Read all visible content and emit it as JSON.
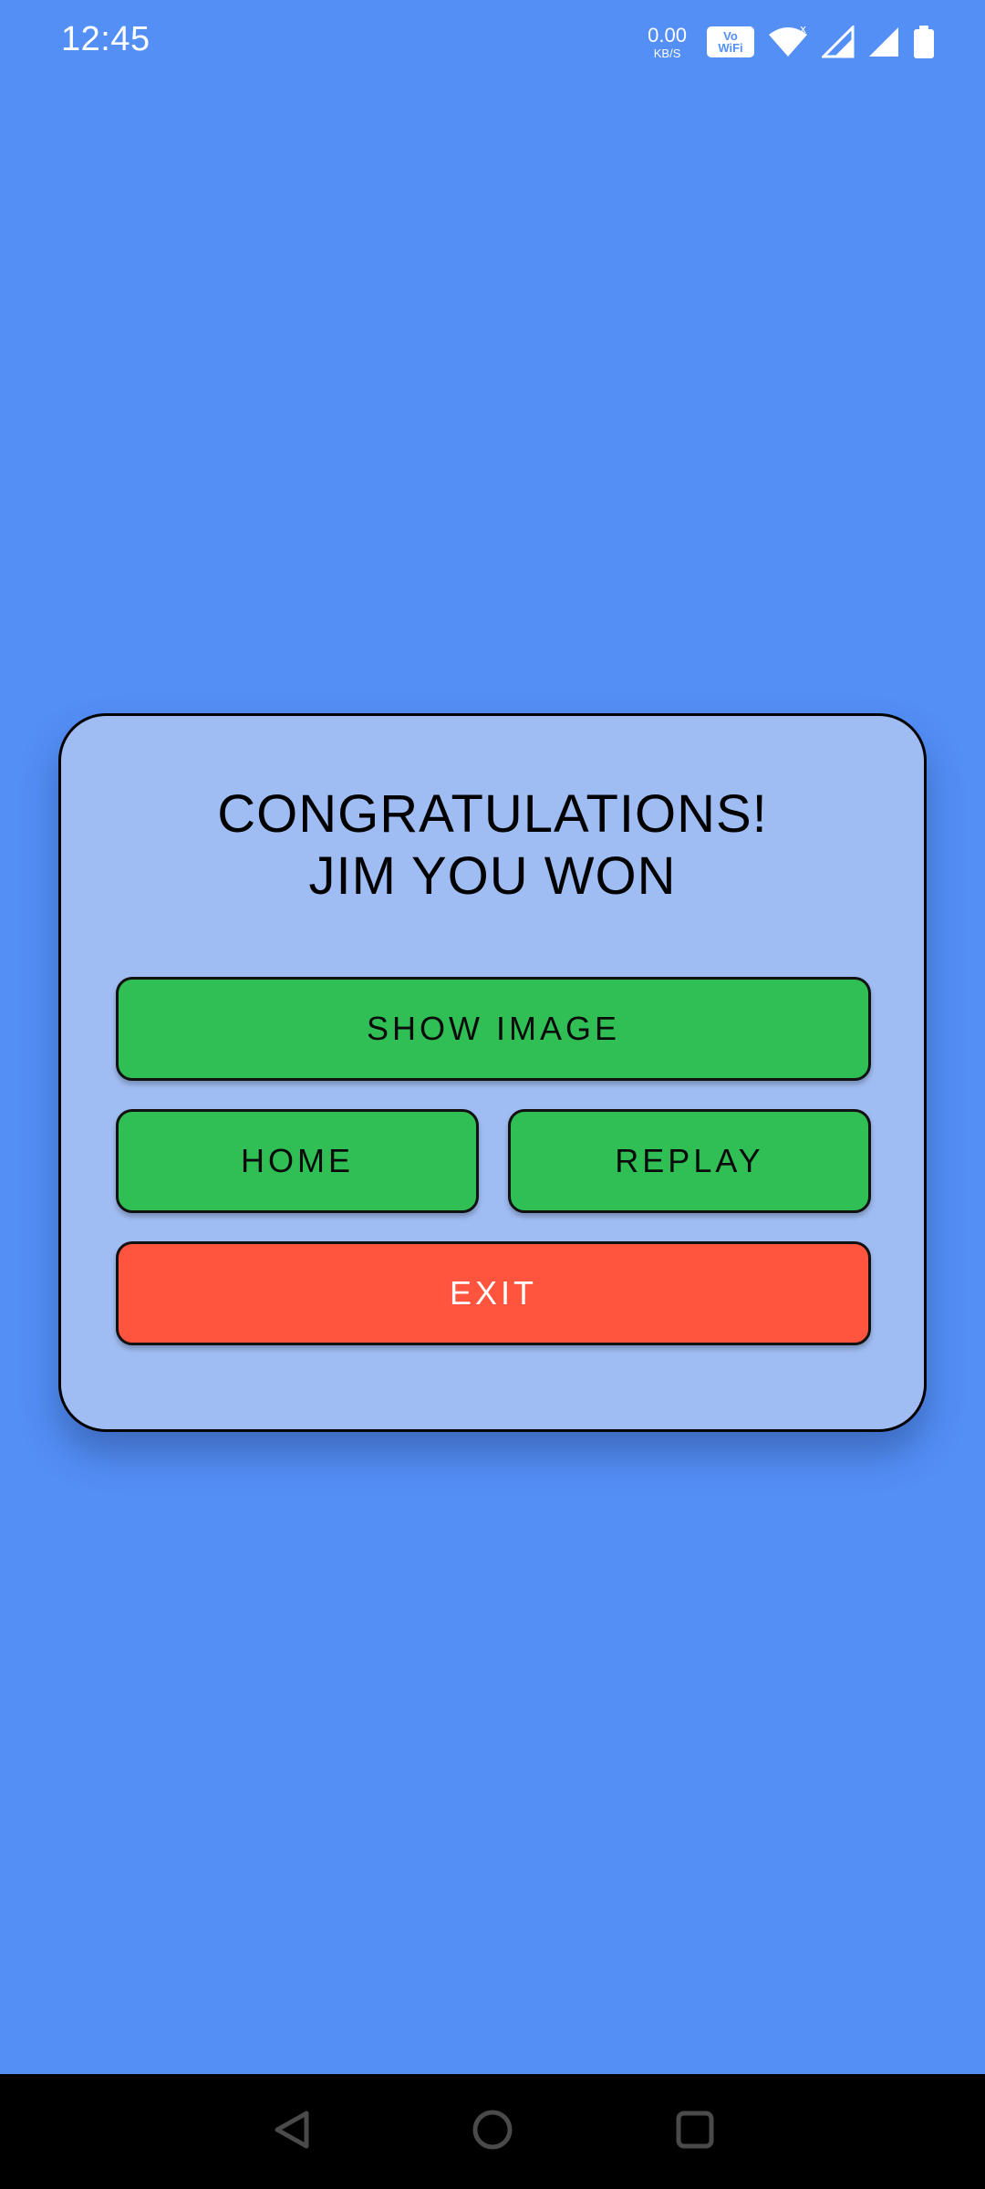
{
  "status_bar": {
    "time": "12:45",
    "net_speed_value": "0.00",
    "net_speed_unit": "KB/S",
    "vowifi_top": "Vo",
    "vowifi_bottom": "WiFi",
    "icons": [
      "vowifi-icon",
      "wifi-icon",
      "signal-icon",
      "signal-icon",
      "battery-icon"
    ]
  },
  "dialog": {
    "title_line1": "CONGRATULATIONS!",
    "title_line2": "JIM YOU WON",
    "buttons": {
      "show_image": "SHOW IMAGE",
      "home": "HOME",
      "replay": "REPLAY",
      "exit": "EXIT"
    }
  },
  "nav_bar": {
    "icons": [
      "back-icon",
      "home-icon",
      "recents-icon"
    ]
  },
  "colors": {
    "background": "#548ff6",
    "dialog": "#a0bdf3",
    "green_button": "#2fbf55",
    "exit_button": "#ff553e",
    "nav_bar": "#000000"
  }
}
